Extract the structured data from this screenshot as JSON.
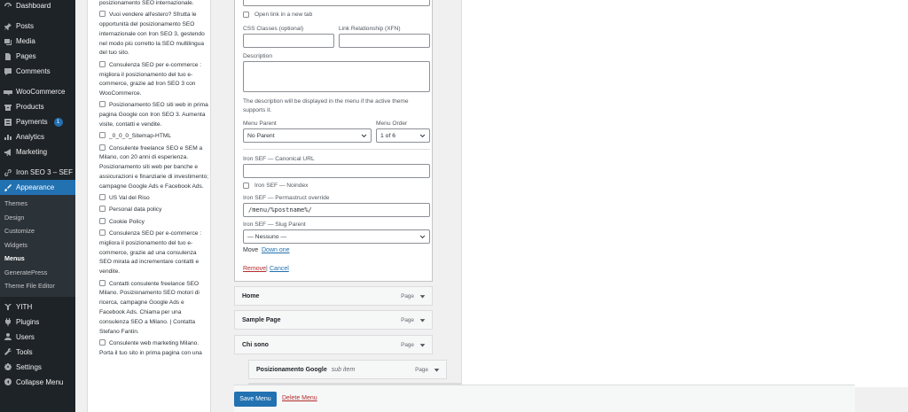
{
  "sidebar": {
    "items": [
      {
        "label": "Dashboard",
        "icon": "dashboard-icon"
      },
      {
        "label": "Posts",
        "icon": "pin-icon"
      },
      {
        "label": "Media",
        "icon": "media-icon"
      },
      {
        "label": "Pages",
        "icon": "pages-icon"
      },
      {
        "label": "Comments",
        "icon": "comments-icon"
      },
      {
        "label": "WooCommerce",
        "icon": "woocommerce-icon"
      },
      {
        "label": "Products",
        "icon": "products-icon"
      },
      {
        "label": "Payments",
        "icon": "payments-icon",
        "badge": "1"
      },
      {
        "label": "Analytics",
        "icon": "analytics-icon"
      },
      {
        "label": "Marketing",
        "icon": "megaphone-icon"
      },
      {
        "label": "Iron SEO 3 – SEF",
        "icon": "link-icon"
      },
      {
        "label": "Appearance",
        "icon": "brush-icon"
      },
      {
        "label": "YITH",
        "icon": "yith-icon"
      },
      {
        "label": "Plugins",
        "icon": "plugins-icon"
      },
      {
        "label": "Users",
        "icon": "users-icon"
      },
      {
        "label": "Tools",
        "icon": "tools-icon"
      },
      {
        "label": "Settings",
        "icon": "settings-icon"
      },
      {
        "label": "Collapse Menu",
        "icon": "collapse-icon"
      }
    ],
    "submenu": [
      "Themes",
      "Design",
      "Customize",
      "Widgets",
      "Menus",
      "GeneratePress",
      "Theme File Editor"
    ]
  },
  "pages_list": [
    {
      "text": "posizionamento SEO internazionale.",
      "checkbox": false
    },
    {
      "text": "Vuoi vendere all'estero? Sfrutta le opportunità del posizionamento SEO internazionale con Iron SEO 3, gestendo nel modo più corretto la SEO multilingua del tuo sito.",
      "checkbox": true
    },
    {
      "text": "Consulenza SEO per e-commerce : migliora il posizionamento del tuo e-commerce, grazie ad Iron SEO 3 con WooCommerce.",
      "checkbox": true
    },
    {
      "text": "Posizionamento SEO siti web in prima pagina Google con Iron SEO 3. Aumenta visite, contatti e vendite.",
      "checkbox": true
    },
    {
      "text": "_0_0_0_Sitemap-HTML",
      "checkbox": true
    },
    {
      "text": "Consulente freelance SEO e SEM a Milano, con 20 anni di esperienza. Posizionamento siti web per banche e assicurazioni e finanziarie di investimento; campagne Google Ads e Facebook Ads.",
      "checkbox": true
    },
    {
      "text": "US Val del Riso",
      "checkbox": true
    },
    {
      "text": "Personal data policy",
      "checkbox": true
    },
    {
      "text": "Cookie Policy",
      "checkbox": true
    },
    {
      "text": "Consulenza SEO per e-commerce : migliora il posizionamento del tuo e-commerce, grazie ad una consulenza SEO mirata ad incrementare contatti e vendite.",
      "checkbox": true
    },
    {
      "text": "Contatti consulente freelance SEO Milano. Posizionamento SEO motori di ricerca, campagne Google Ads e Facebook Ads. Chiama per una consulenza SEO a Milano. | Contatta Stefano Fantin.",
      "checkbox": true
    },
    {
      "text": "Consulente web marketing Milano. Porta il tuo sito in prima pagina con una",
      "checkbox": true
    }
  ],
  "edit": {
    "open_new_tab": "Open link in a new tab",
    "css_classes": "CSS Classes (optional)",
    "link_rel": "Link Relationship (XFN)",
    "description": "Description",
    "description_help": "The description will be displayed in the menu if the active theme supports it.",
    "menu_parent": "Menu Parent",
    "menu_parent_value": "No Parent",
    "menu_order": "Menu Order",
    "menu_order_value": "1 of 6",
    "canonical": "Iron SEF — Canonical URL",
    "noindex": "Iron SEF — Noindex",
    "permastruct": "Iron SEF — Permastruct override",
    "permastruct_value": "/menu/%postname%/",
    "slug_parent": "Iron SEF — Slug Parent",
    "slug_parent_value": "— Nessuno —",
    "move": "Move",
    "down_one": "Down one",
    "remove": "Remove",
    "sep": "|",
    "cancel": "Cancel"
  },
  "menu_items": [
    {
      "title": "Home",
      "type": "Page",
      "sub": ""
    },
    {
      "title": "Sample Page",
      "type": "Page",
      "sub": ""
    },
    {
      "title": "Chi sono",
      "type": "Page",
      "sub": ""
    },
    {
      "title": "Posizionamento Google",
      "type": "Page",
      "sub": "sub item"
    }
  ],
  "footer": {
    "save": "Save Menu",
    "delete": "Delete Menu"
  }
}
